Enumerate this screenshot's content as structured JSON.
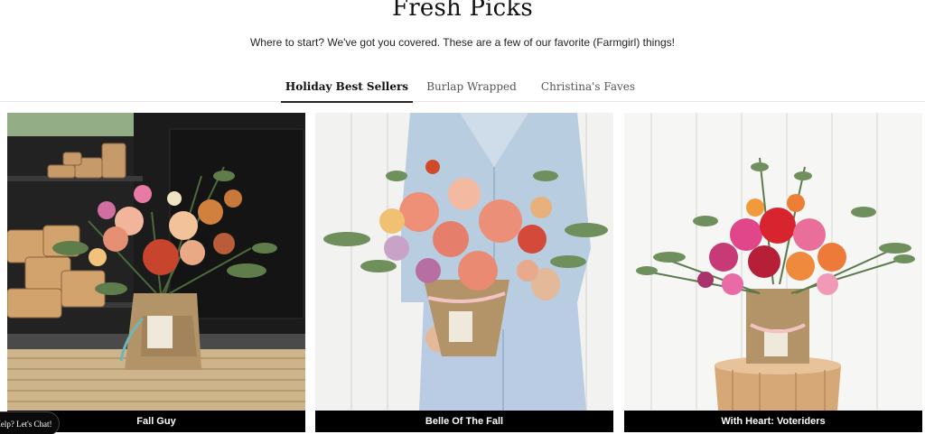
{
  "section": {
    "title": "Fresh Picks",
    "subtitle": "Where to start? We've got you covered. These are a few of our favorite (Farmgirl) things!"
  },
  "tabs": [
    {
      "label": "Holiday Best Sellers",
      "active": true
    },
    {
      "label": "Burlap Wrapped",
      "active": false
    },
    {
      "label": "Christina's Faves",
      "active": false
    }
  ],
  "products": [
    {
      "name": "Fall Guy"
    },
    {
      "name": "Belle Of The Fall"
    },
    {
      "name": "With Heart: Voteriders"
    }
  ],
  "chat": {
    "label": "Help? Let's Chat!"
  },
  "colors": {
    "caption_bg": "#000000",
    "active_tab_underline": "#222222"
  }
}
